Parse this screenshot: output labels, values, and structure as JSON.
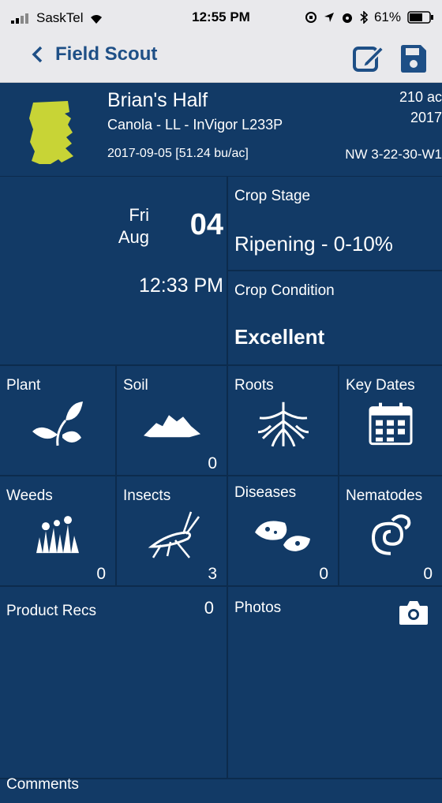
{
  "status": {
    "carrier": "SaskTel",
    "time": "12:55 PM",
    "battery": "61%"
  },
  "nav": {
    "back_label": "Field Scout",
    "edit_icon": "edit-icon",
    "save_icon": "save-icon"
  },
  "field": {
    "name": "Brian's Half",
    "crop": "Canola - LL - InVigor L233P",
    "harvest": "2017-09-05 [51.24 bu/ac]",
    "acres": "210 ac",
    "year": "2017",
    "legal": "NW 3-22-30-W1",
    "shape_color": "#c8d436"
  },
  "scout": {
    "weekday": "Fri",
    "month": "Aug",
    "day": "04",
    "time": "12:33 PM"
  },
  "crop_stage": {
    "label": "Crop Stage",
    "value": "Ripening - 0-10%"
  },
  "crop_condition": {
    "label": "Crop Condition",
    "value": "Excellent"
  },
  "tiles": {
    "plant": {
      "label": "Plant",
      "icon": "plant-icon"
    },
    "soil": {
      "label": "Soil",
      "count": "0",
      "icon": "soil-icon"
    },
    "roots": {
      "label": "Roots",
      "icon": "roots-icon"
    },
    "key_dates": {
      "label": "Key Dates",
      "icon": "calendar-icon"
    },
    "weeds": {
      "label": "Weeds",
      "count": "0",
      "icon": "weeds-icon"
    },
    "insects": {
      "label": "Insects",
      "count": "3",
      "icon": "insect-icon"
    },
    "diseases": {
      "label": "Diseases",
      "count": "0",
      "icon": "disease-icon"
    },
    "nematodes": {
      "label": "Nematodes",
      "count": "0",
      "icon": "nematode-icon"
    }
  },
  "product_recs": {
    "label": "Product Recs",
    "count": "0"
  },
  "photos": {
    "label": "Photos",
    "icon": "camera-icon"
  },
  "comments": {
    "label": "Comments"
  },
  "colors": {
    "background": "#123a66",
    "divider": "#0c2b4d",
    "nav_blue": "#1e4f86",
    "bar_gray": "#e9e9ec"
  }
}
